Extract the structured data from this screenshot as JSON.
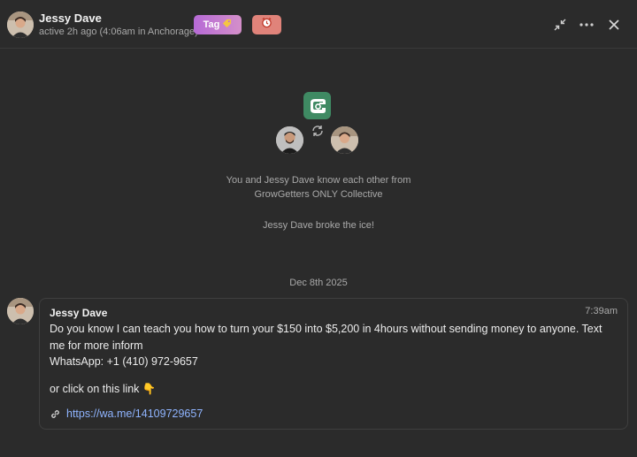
{
  "header": {
    "name": "Jessy Dave",
    "status": "active 2h ago (4:06am in Anchorage)",
    "tag_label": "Tag",
    "icons": [
      "minimize-icon",
      "more-icon",
      "close-icon"
    ]
  },
  "intro": {
    "know_line_1": "You and Jessy Dave know each other from",
    "know_line_2": "GrowGetters ONLY Collective",
    "icebreaker": "Jessy Dave broke the ice!",
    "community_logo_text": "GG"
  },
  "date_separator": "Dec 8th 2025",
  "message": {
    "sender": "Jessy Dave",
    "time": "7:39am",
    "line_1": "Do you know I can teach you how to turn your $150 into $5,200 in 4hours without sending money to anyone. Text me for more inform",
    "line_2": "WhatsApp: +1 (410) 972-9657",
    "line_3": "or click on this link 👇",
    "link": "https://wa.me/14109729657"
  },
  "colors": {
    "background": "#2b2b2b",
    "tag_gradient_start": "#b66ad6",
    "tag_gradient_end": "#d48fc9",
    "alarm_button": "#e0837a",
    "community_logo": "#3f8a63",
    "link": "#8fb4ff"
  }
}
